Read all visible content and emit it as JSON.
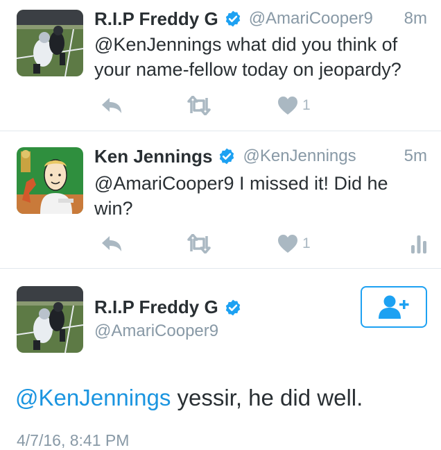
{
  "tweets": [
    {
      "display_name": "R.I.P Freddy G",
      "handle": "@AmariCooper9",
      "time": "8m",
      "text": "@KenJennings what did you think of your name-fellow today on jeopardy?",
      "like_count": "1",
      "avatar": "football-photo-avatar"
    },
    {
      "display_name": "Ken Jennings",
      "handle": "@KenJennings",
      "time": "5m",
      "text": "@AmariCooper9 I missed it! Did he win?",
      "like_count": "1",
      "avatar": "cartoon-portrait-avatar"
    }
  ],
  "detail": {
    "display_name": "R.I.P Freddy G",
    "handle": "@AmariCooper9",
    "mention": "@KenJennings",
    "text": " yessir, he did well.",
    "date": "4/7/16, 8:41 PM",
    "follow_icon": "add-user-icon"
  },
  "colors": {
    "accent": "#1da1f2",
    "link": "#1b95e0",
    "muted": "#8899a6",
    "action_icon": "#aab8c2",
    "divider": "#e1e8ed"
  }
}
